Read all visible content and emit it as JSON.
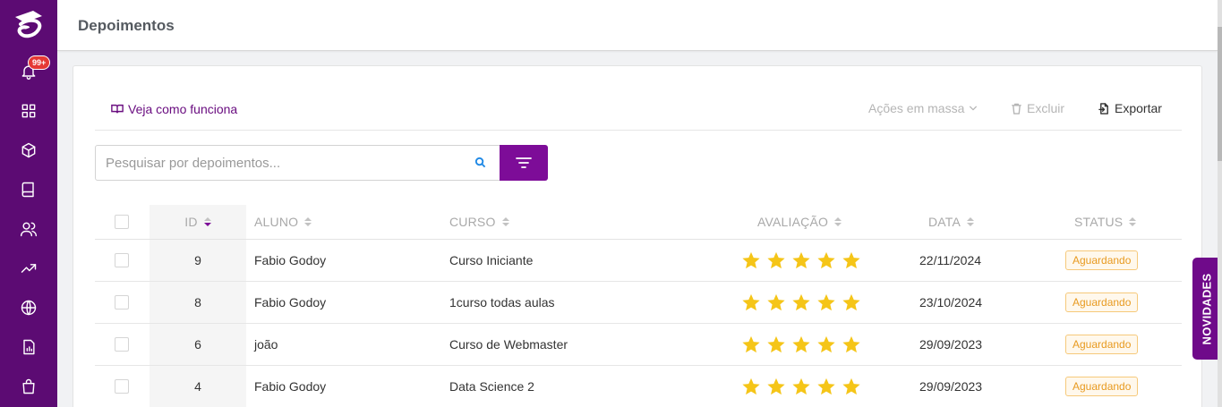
{
  "page": {
    "title": "Depoimentos"
  },
  "sidebar": {
    "notification_badge": "99+",
    "items": [
      {
        "icon": "bell-icon"
      },
      {
        "icon": "grid-icon"
      },
      {
        "icon": "box-icon"
      },
      {
        "icon": "book-icon"
      },
      {
        "icon": "users-icon"
      },
      {
        "icon": "trending-icon"
      },
      {
        "icon": "globe-icon"
      },
      {
        "icon": "report-icon"
      },
      {
        "icon": "shopping-bag-icon"
      }
    ]
  },
  "toolbar": {
    "how_it_works": "Veja como funciona",
    "bulk_actions": "Ações em massa",
    "delete": "Excluir",
    "export": "Exportar"
  },
  "search": {
    "placeholder": "Pesquisar por depoimentos...",
    "value": ""
  },
  "table": {
    "headers": {
      "id": "ID",
      "student": "ALUNO",
      "course": "CURSO",
      "rating": "AVALIAÇÃO",
      "date": "DATA",
      "status": "STATUS"
    },
    "rows": [
      {
        "id": "9",
        "student": "Fabio Godoy",
        "course": "Curso Iniciante",
        "rating": 5,
        "date": "22/11/2024",
        "status": "Aguardando"
      },
      {
        "id": "8",
        "student": "Fabio Godoy",
        "course": "1curso todas aulas",
        "rating": 5,
        "date": "23/10/2024",
        "status": "Aguardando"
      },
      {
        "id": "6",
        "student": "joão",
        "course": "Curso de Webmaster",
        "rating": 5,
        "date": "29/09/2023",
        "status": "Aguardando"
      },
      {
        "id": "4",
        "student": "Fabio Godoy",
        "course": "Data Science 2",
        "rating": 5,
        "date": "29/09/2023",
        "status": "Aguardando"
      }
    ]
  },
  "side_tab": {
    "label": "NOVIDADES"
  },
  "colors": {
    "brand": "#5c0b73",
    "accent": "#7d0c98",
    "star": "#f5c518",
    "status_pending": "#e89a20"
  }
}
